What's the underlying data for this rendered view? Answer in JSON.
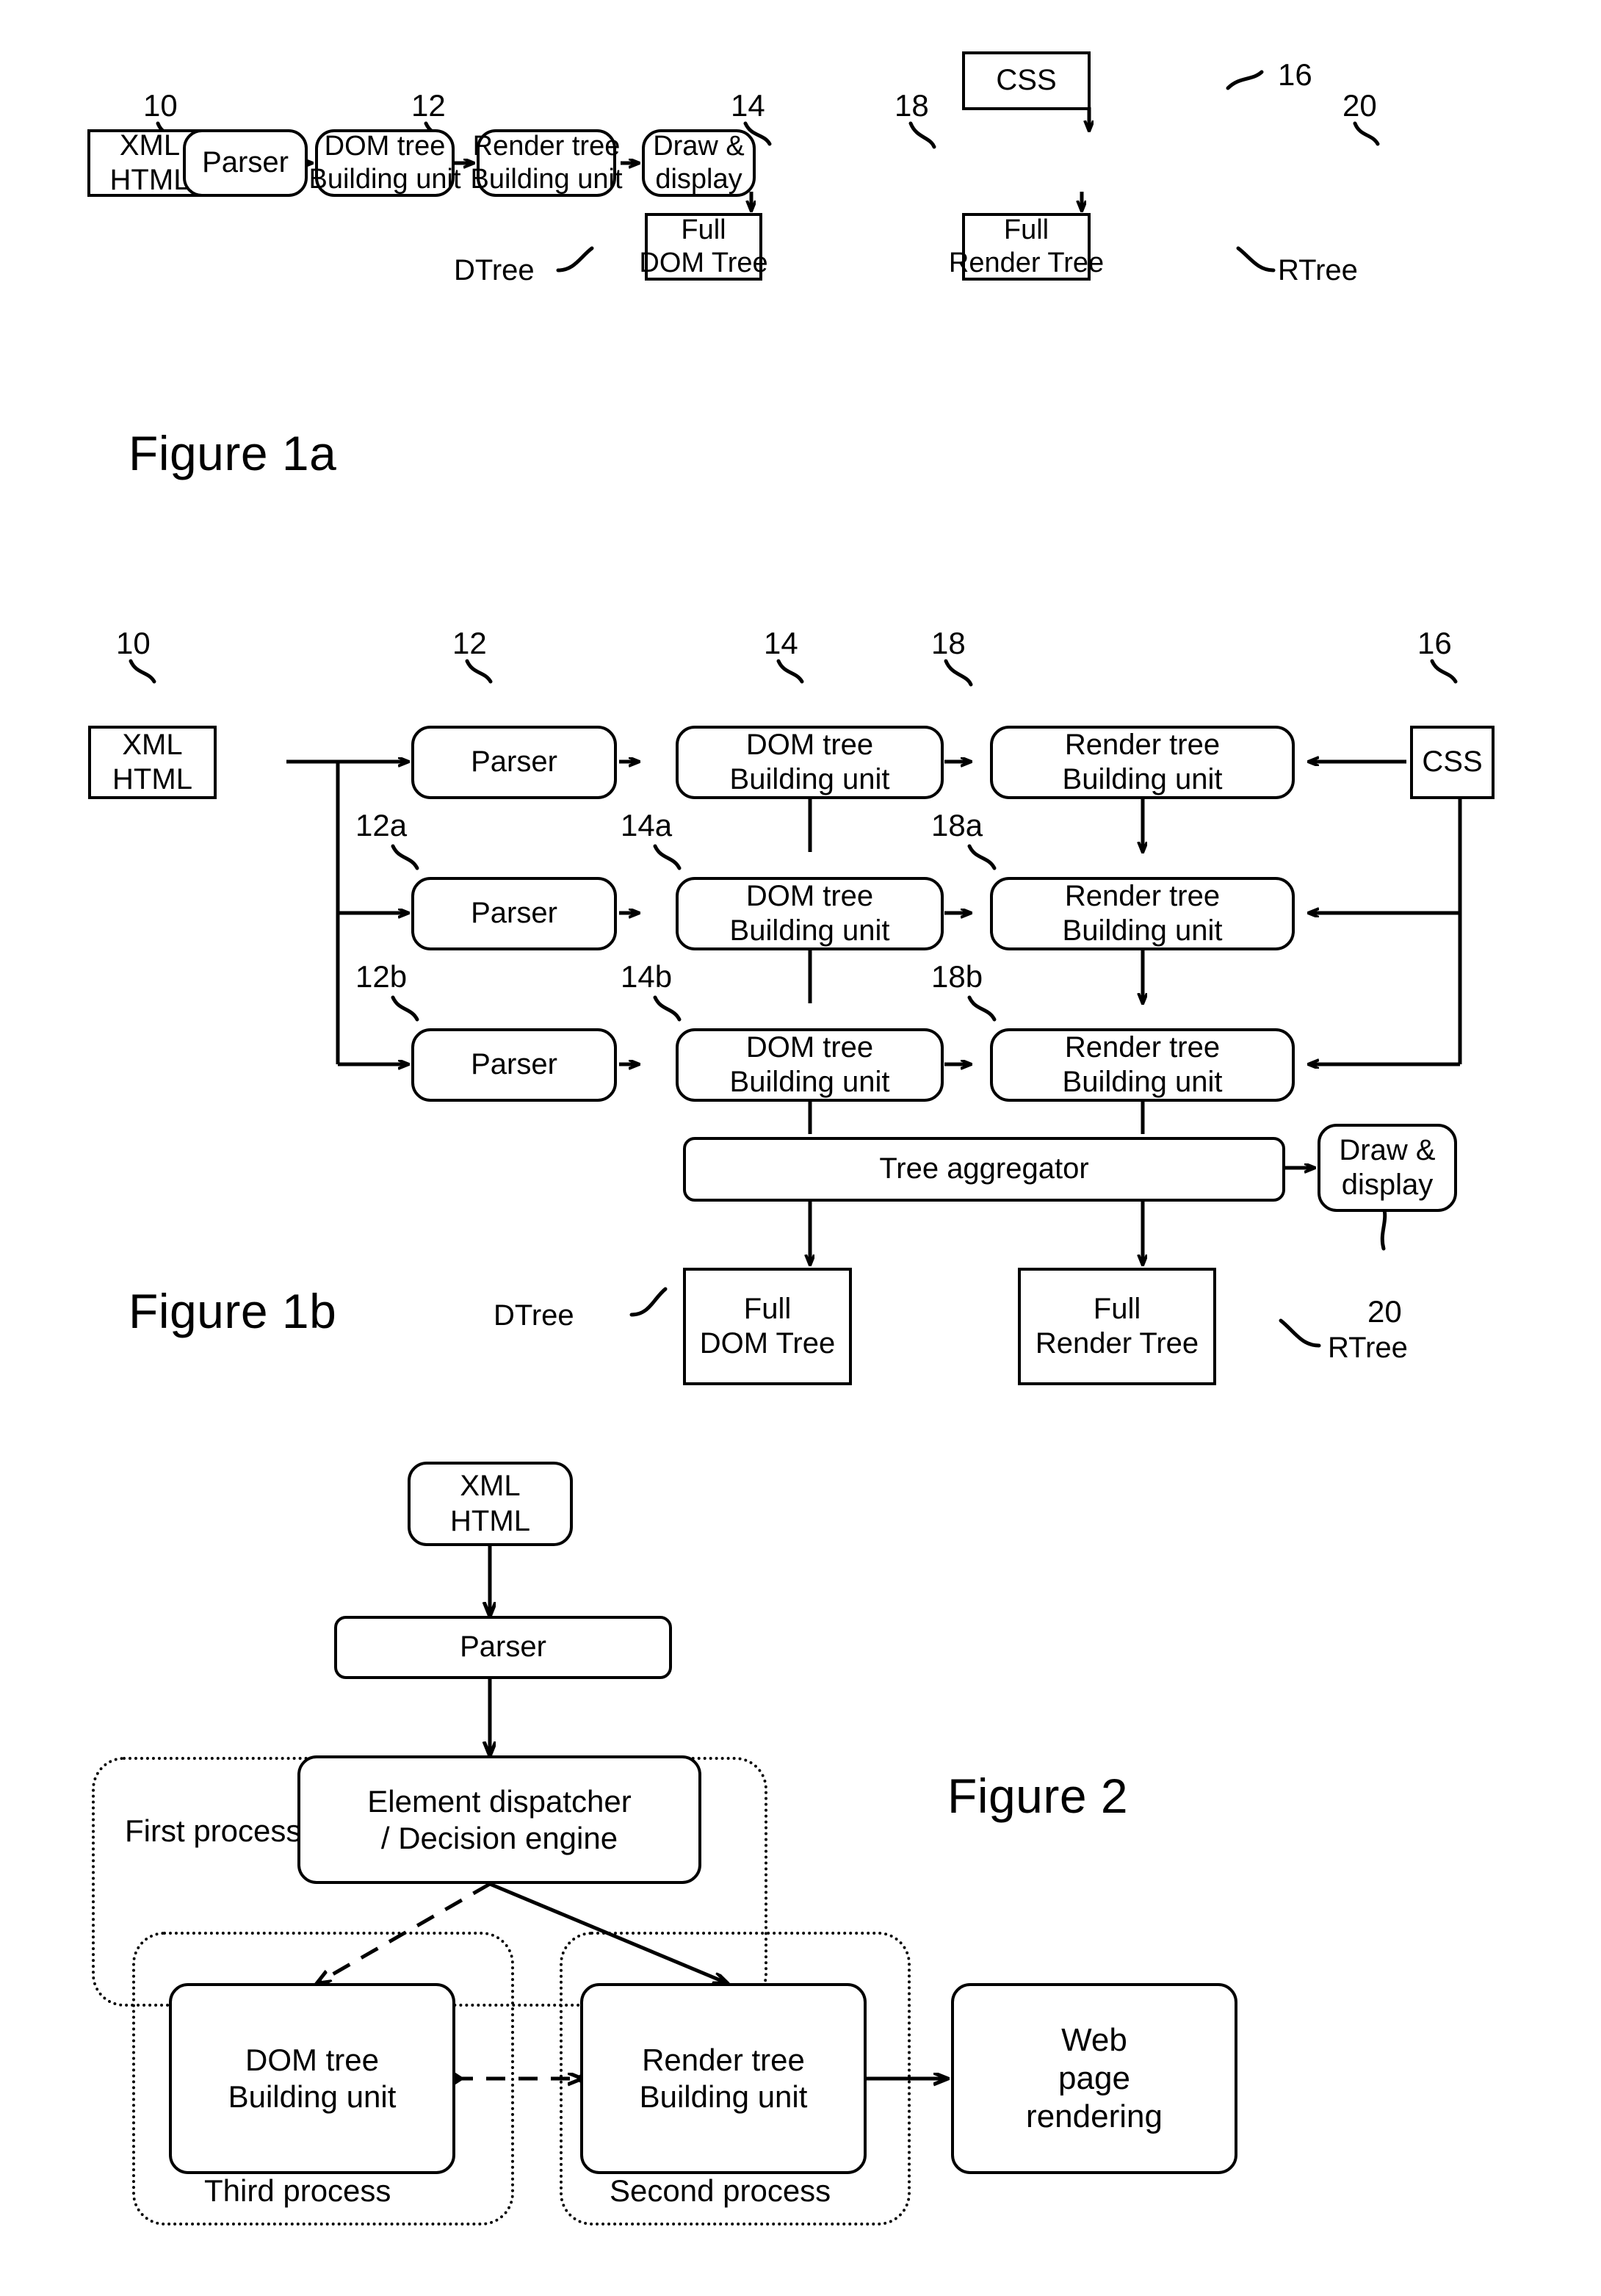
{
  "document": {
    "type": "patent-figure-sheet",
    "figures": [
      "Figure 1a",
      "Figure 1b",
      "Figure 2"
    ]
  },
  "fig1a": {
    "label": "Figure 1a",
    "nodes": {
      "source": {
        "line1": "XML",
        "line2": "HTML"
      },
      "parser": {
        "line1": "Parser"
      },
      "dom": {
        "line1": "DOM tree",
        "line2": "Building unit"
      },
      "render": {
        "line1": "Render tree",
        "line2": "Building unit"
      },
      "draw": {
        "line1": "Draw &",
        "line2": "display"
      },
      "css": {
        "line1": "CSS"
      },
      "fulldom": {
        "line1": "Full",
        "line2": "DOM Tree"
      },
      "fullrender": {
        "line1": "Full",
        "line2": "Render Tree"
      }
    },
    "refs": {
      "source": "10",
      "parser": "12",
      "dom": "14",
      "render": "18",
      "css": "16",
      "draw": "20"
    },
    "tags": {
      "dtree": "DTree",
      "rtree": "RTree"
    }
  },
  "fig1b": {
    "label": "Figure 1b",
    "nodes": {
      "source": {
        "line1": "XML",
        "line2": "HTML"
      },
      "parser0": {
        "line1": "Parser"
      },
      "parser1": {
        "line1": "Parser"
      },
      "parser2": {
        "line1": "Parser"
      },
      "dom0": {
        "line1": "DOM tree",
        "line2": "Building unit"
      },
      "dom1": {
        "line1": "DOM tree",
        "line2": "Building unit"
      },
      "dom2": {
        "line1": "DOM tree",
        "line2": "Building unit"
      },
      "render0": {
        "line1": "Render tree",
        "line2": "Building unit"
      },
      "render1": {
        "line1": "Render tree",
        "line2": "Building unit"
      },
      "render2": {
        "line1": "Render tree",
        "line2": "Building unit"
      },
      "css": {
        "line1": "CSS"
      },
      "aggregator": {
        "line1": "Tree aggregator"
      },
      "draw": {
        "line1": "Draw &",
        "line2": "display"
      },
      "fulldom": {
        "line1": "Full",
        "line2": "DOM Tree"
      },
      "fullrender": {
        "line1": "Full",
        "line2": "Render Tree"
      }
    },
    "refs": {
      "source": "10",
      "parser0": "12",
      "parser1": "12a",
      "parser2": "12b",
      "dom0": "14",
      "dom1": "14a",
      "dom2": "14b",
      "render0": "18",
      "render1": "18a",
      "render2": "18b",
      "css": "16",
      "draw": "20"
    },
    "tags": {
      "dtree": "DTree",
      "rtree": "RTree"
    }
  },
  "fig2": {
    "label": "Figure 2",
    "nodes": {
      "source": {
        "line1": "XML",
        "line2": "HTML"
      },
      "parser": {
        "line1": "Parser"
      },
      "dispatcher": {
        "line1": "Element dispatcher",
        "line2": "/ Decision engine"
      },
      "dom": {
        "line1": "DOM tree",
        "line2": "Building unit"
      },
      "render": {
        "line1": "Render tree",
        "line2": "Building unit"
      },
      "web": {
        "line1": "Web",
        "line2": "page",
        "line3": "rendering"
      }
    },
    "processes": {
      "first": {
        "line1": "First",
        "line2": "process"
      },
      "third": {
        "line1": "Third process"
      },
      "second": {
        "line1": "Second process"
      }
    }
  }
}
